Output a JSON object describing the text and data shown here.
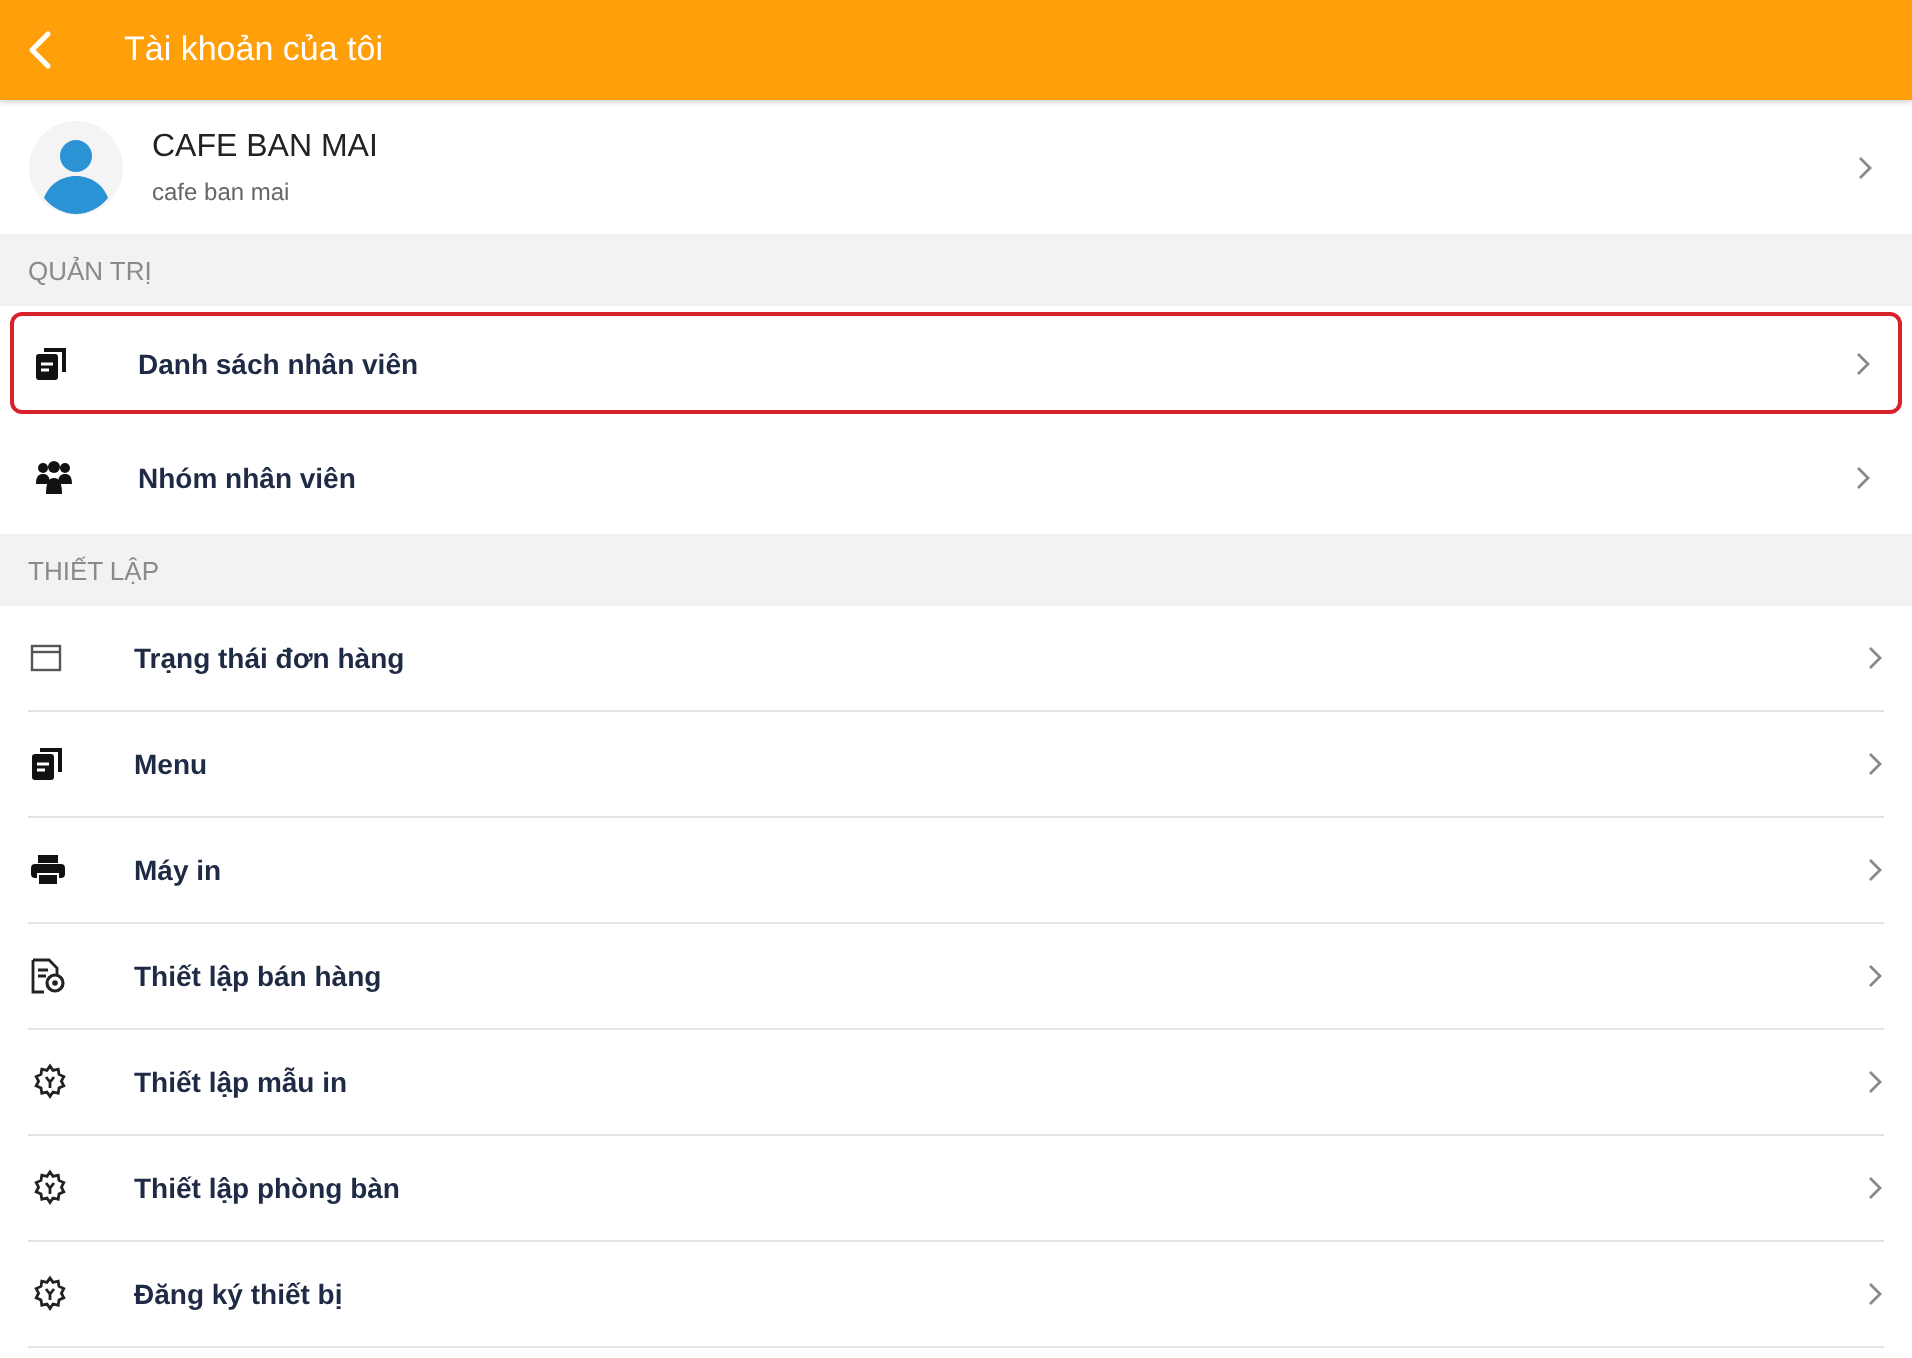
{
  "header": {
    "title": "Tài khoản của tôi"
  },
  "profile": {
    "name": "CAFE BAN MAI",
    "subtitle": "cafe ban mai"
  },
  "sections": [
    {
      "title": "QUẢN TRỊ",
      "items": [
        {
          "label": "Danh sách nhân viên",
          "kind": "documents",
          "selected": true
        },
        {
          "label": "Nhóm nhân viên",
          "kind": "people",
          "selected": false
        }
      ]
    },
    {
      "title": "THIẾT LẬP",
      "items": [
        {
          "label": "Trạng thái đơn hàng",
          "kind": "window",
          "selected": false
        },
        {
          "label": "Menu",
          "kind": "documents",
          "selected": false
        },
        {
          "label": "Máy in",
          "kind": "printer",
          "selected": false
        },
        {
          "label": "Thiết lập bán hàng",
          "kind": "file-gear",
          "selected": false
        },
        {
          "label": "Thiết lập mẫu in",
          "kind": "gear",
          "selected": false
        },
        {
          "label": "Thiết lập phòng bàn",
          "kind": "gear",
          "selected": false
        },
        {
          "label": "Đăng ký thiết bị",
          "kind": "gear",
          "selected": false
        }
      ]
    }
  ]
}
